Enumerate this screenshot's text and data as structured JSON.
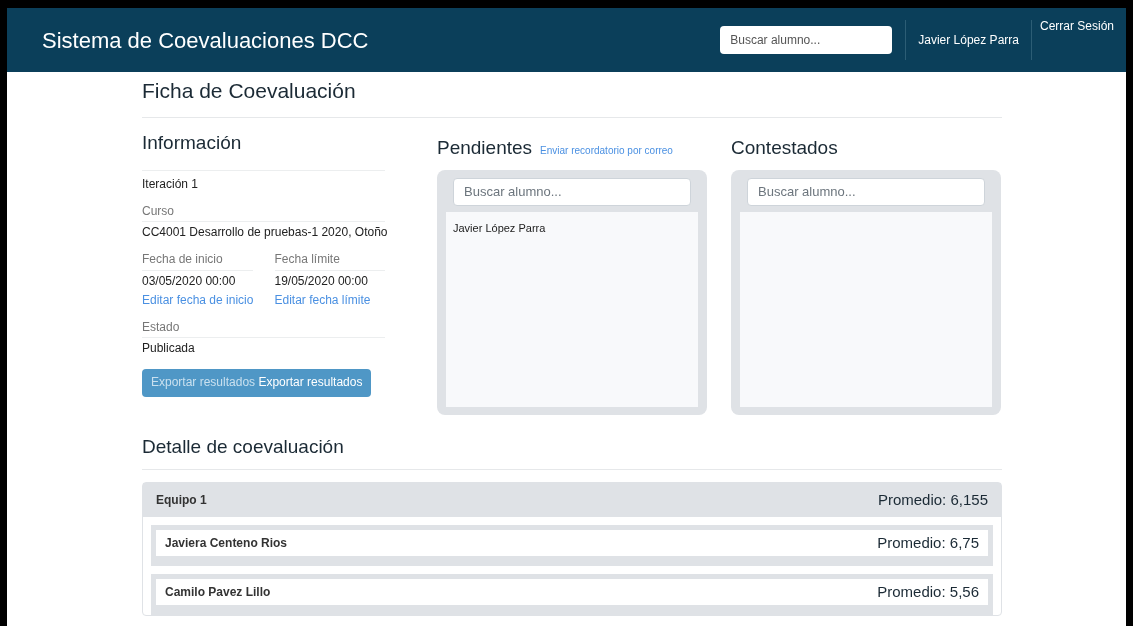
{
  "navbar": {
    "brand": "Sistema de Coevaluaciones DCC",
    "search": {
      "placeholder": "Buscar alumno..."
    },
    "user": "Javier López Parra",
    "logout": "Cerrar Sesión"
  },
  "page_title": "Ficha de Coevaluación",
  "info": {
    "title": "Información",
    "name": "Iteración 1",
    "course_label": "Curso",
    "course": "CC4001 Desarrollo de pruebas-1 2020, Otoño",
    "dates": [
      {
        "label": "Fecha de inicio",
        "value": "03/05/2020 00:00",
        "link": "Editar fecha de inicio"
      },
      {
        "label": "Fecha límite",
        "value": "19/05/2020 00:00",
        "link": "Editar fecha límite"
      }
    ],
    "status_label": "Estado",
    "status": "Publicada",
    "export_button": {
      "faded_label": "Exportar resultados",
      "label": "Exportar resultados"
    }
  },
  "pending": {
    "title": "Pendientes",
    "link": "Enviar recordatorio por correo",
    "search": {
      "placeholder": "Buscar alumno..."
    },
    "students": [
      "Javier López Parra"
    ]
  },
  "answered": {
    "title": "Contestados",
    "search": {
      "placeholder": "Buscar alumno..."
    }
  },
  "detail": {
    "title": "Detalle de coevaluación",
    "teams": [
      {
        "name": "Equipo 1",
        "average": "Promedio: 6,155",
        "members": [
          {
            "name": "Javiera Centeno Rios",
            "average": "Promedio: 6,75"
          },
          {
            "name": "Camilo Pavez Lillo",
            "average": "Promedio: 5,56"
          }
        ]
      }
    ]
  }
}
